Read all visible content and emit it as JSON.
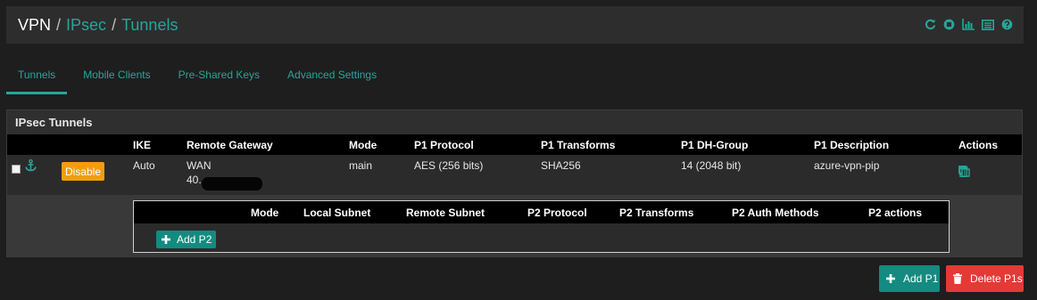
{
  "breadcrumb": {
    "root": "VPN",
    "sep1": "/",
    "ipsec": "IPsec",
    "sep2": "/",
    "current": "Tunnels"
  },
  "header_icons": [
    "reload-icon",
    "stop-icon",
    "status-chart-icon",
    "log-icon",
    "help-icon"
  ],
  "tabs": [
    {
      "label": "Tunnels",
      "active": true
    },
    {
      "label": "Mobile Clients",
      "active": false
    },
    {
      "label": "Pre-Shared Keys",
      "active": false
    },
    {
      "label": "Advanced Settings",
      "active": false
    }
  ],
  "panel": {
    "title": "IPsec Tunnels",
    "columns": [
      "IKE",
      "Remote Gateway",
      "Mode",
      "P1 Protocol",
      "P1 Transforms",
      "P1 DH-Group",
      "P1 Description",
      "Actions"
    ],
    "rows": [
      {
        "disable_label": "Disable",
        "ike": "Auto",
        "gateway_line1": "WAN",
        "gateway_line2": "40.",
        "mode": "main",
        "p1_protocol": "AES (256 bits)",
        "p1_transforms": "SHA256",
        "p1_dh_group": "14 (2048 bit)",
        "p1_description": "azure-vpn-pip"
      }
    ],
    "p2": {
      "columns": [
        "Mode",
        "Local Subnet",
        "Remote Subnet",
        "P2 Protocol",
        "P2 Transforms",
        "P2 Auth Methods",
        "P2 actions"
      ],
      "add_label": "Add P2"
    }
  },
  "buttons": {
    "add_p1": "Add P1",
    "delete_p1s": "Delete P1s"
  },
  "colors": {
    "accent": "#26a69a",
    "success": "#138b80",
    "warning": "#f39c12",
    "danger": "#e53935",
    "background": "#1e1e1e"
  }
}
